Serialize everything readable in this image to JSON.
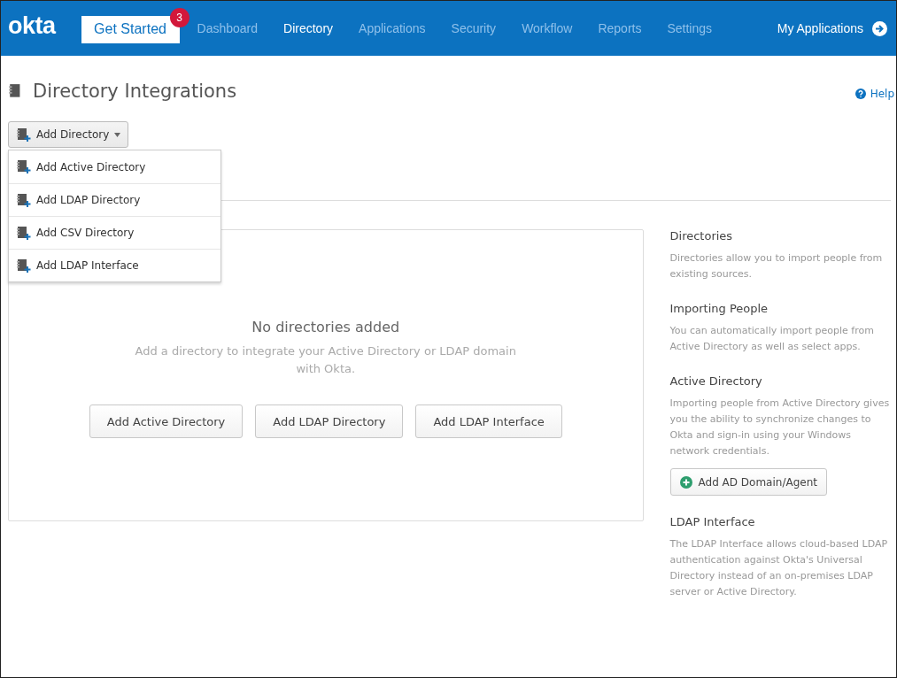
{
  "header": {
    "logo": "okta",
    "get_started": {
      "label": "Get Started",
      "badge": "3"
    },
    "nav": [
      {
        "label": "Dashboard",
        "selected": false
      },
      {
        "label": "Directory",
        "selected": true
      },
      {
        "label": "Applications",
        "selected": false
      },
      {
        "label": "Security",
        "selected": false
      },
      {
        "label": "Workflow",
        "selected": false
      },
      {
        "label": "Reports",
        "selected": false
      },
      {
        "label": "Settings",
        "selected": false
      }
    ],
    "my_applications": "My Applications"
  },
  "page": {
    "title": "Directory Integrations",
    "help": "Help"
  },
  "add_directory": {
    "label": "Add Directory",
    "expanded": true,
    "menu": [
      "Add Active Directory",
      "Add LDAP Directory",
      "Add CSV Directory",
      "Add LDAP Interface"
    ]
  },
  "empty_state": {
    "title": "No directories added",
    "text": "Add a directory to integrate your Active Directory or LDAP domain with Okta.",
    "buttons": [
      "Add Active Directory",
      "Add LDAP Directory",
      "Add LDAP Interface"
    ]
  },
  "sidebar": [
    {
      "title": "Directories",
      "text": "Directories allow you to import people from existing sources."
    },
    {
      "title": "Importing People",
      "text": "You can automatically import people from Active Directory as well as select apps."
    },
    {
      "title": "Active Directory",
      "text": "Importing people from Active Directory gives you the ability to synchronize changes to Okta and sign-in using your Windows network credentials.",
      "button": "Add AD Domain/Agent"
    },
    {
      "title": "LDAP Interface",
      "text": "The LDAP Interface allows cloud-based LDAP authentication against Okta's Universal Directory instead of an on-premises LDAP server or Active Directory."
    }
  ]
}
